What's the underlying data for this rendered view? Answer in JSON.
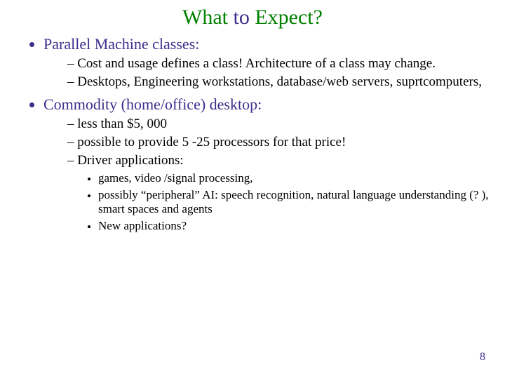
{
  "title": {
    "word1": "What",
    "word2": "to",
    "word3": "Expect?"
  },
  "bullets": [
    {
      "text": "Parallel Machine classes:",
      "sub": [
        {
          "text": "Cost and usage defines a class! Architecture of a class may change."
        },
        {
          "text": "Desktops, Engineering workstations, database/web servers, suprtcomputers,"
        }
      ]
    },
    {
      "text": "Commodity (home/office) desktop:",
      "sub": [
        {
          "text": "less than $5, 000"
        },
        {
          "text": "possible to provide 5 -25 processors for that price!"
        },
        {
          "text": "Driver applications:",
          "sub": [
            {
              "text": "games, video /signal processing,"
            },
            {
              "text": "possibly “peripheral” AI:  speech recognition, natural language understanding (? ), smart spaces and agents"
            },
            {
              "text": "New applications?"
            }
          ]
        }
      ]
    }
  ],
  "page_number": "8"
}
